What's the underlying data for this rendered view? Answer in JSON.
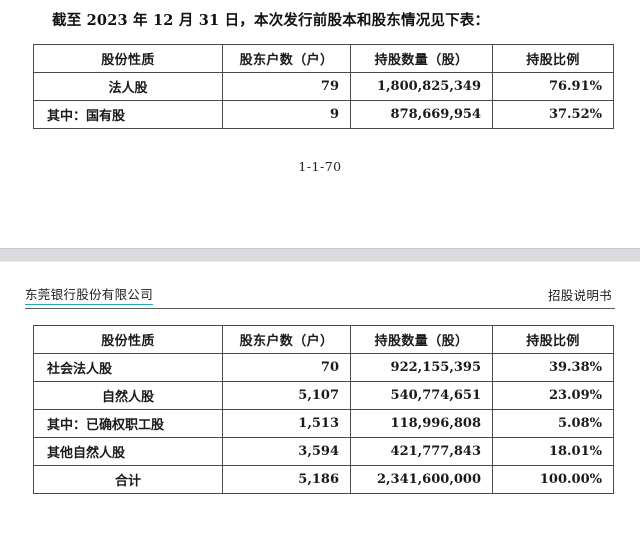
{
  "document": {
    "page_one": {
      "intro_text": "截至 2023 年 12 月 31 日，本次发行前股本和股东情况见下表：",
      "page_number": "1-1-70",
      "table": {
        "headers": [
          "股份性质",
          "股东户数（户）",
          "持股数量（股）",
          "持股比例"
        ],
        "rows": [
          {
            "nature": "法人股",
            "align": "center",
            "holders": "79",
            "amount": "1,800,825,349",
            "ratio": "76.91%"
          },
          {
            "nature": "其中：国有股",
            "align": "left",
            "holders": "9",
            "amount": "878,669,954",
            "ratio": "37.52%"
          }
        ]
      }
    },
    "page_two": {
      "header": {
        "company": "东莞银行股份有限公司",
        "doc_type": "招股说明书"
      },
      "table": {
        "headers": [
          "股份性质",
          "股东户数（户）",
          "持股数量（股）",
          "持股比例"
        ],
        "rows": [
          {
            "nature": "社会法人股",
            "align": "left",
            "holders": "70",
            "amount": "922,155,395",
            "ratio": "39.38%"
          },
          {
            "nature": "自然人股",
            "align": "center",
            "holders": "5,107",
            "amount": "540,774,651",
            "ratio": "23.09%"
          },
          {
            "nature": "其中：已确权职工股",
            "align": "left",
            "holders": "1,513",
            "amount": "118,996,808",
            "ratio": "5.08%"
          },
          {
            "nature": "其他自然人股",
            "align": "left",
            "holders": "3,594",
            "amount": "421,777,843",
            "ratio": "18.01%"
          },
          {
            "nature": "合计",
            "align": "center",
            "holders": "5,186",
            "amount": "2,341,600,000",
            "ratio": "100.00%"
          }
        ]
      }
    }
  },
  "colors": {
    "company_underline": "#2aa7bf",
    "page_separator": "#d9dbde",
    "table_border": "#4a4a4a"
  }
}
